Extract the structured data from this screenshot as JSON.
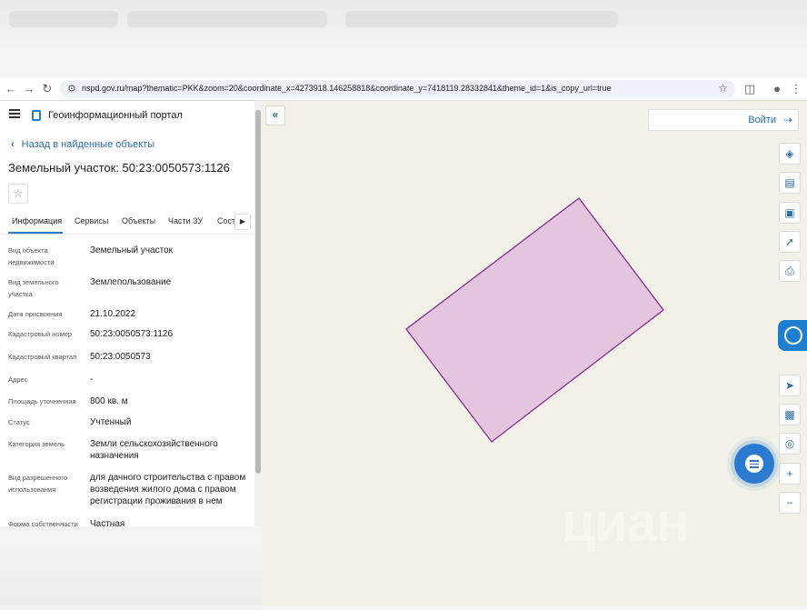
{
  "browser": {
    "url": "nspd.gov.ru/map?thematic=PKK&zoom=20&coordinate_x=4273918.146258818&coordinate_y=7418119.28332841&theme_id=1&is_copy_url=true"
  },
  "header": {
    "portal_title": "Геоинформационный портал",
    "login_label": "Войти"
  },
  "panel": {
    "back_label": "Назад в найденные объекты",
    "object_title": "Земельный участок: 50:23:0050573:1126",
    "tabs": [
      {
        "label": "Информация"
      },
      {
        "label": "Сервисы"
      },
      {
        "label": "Объекты"
      },
      {
        "label": "Части ЗУ"
      },
      {
        "label": "Соста"
      }
    ],
    "rows": [
      {
        "label": "Вид объекта недвижимости",
        "value": "Земельный участок"
      },
      {
        "label": "Вид земельного участка",
        "value": "Землепользование"
      },
      {
        "label": "Дата присвоения",
        "value": "21.10.2022"
      },
      {
        "label": "Кадастровый номер",
        "value": "50:23:0050573:1126"
      },
      {
        "label": "Кадастровый квартал",
        "value": "50:23:0050573"
      },
      {
        "label": "Адрес",
        "value": "-"
      },
      {
        "label": "Площадь уточненная",
        "value": "800 кв. м"
      },
      {
        "label": "Статус",
        "value": "Учтенный"
      },
      {
        "label": "Категория земель",
        "value": "Земли сельскохозяйственного назначения"
      },
      {
        "label": "Вид разрешенного использования",
        "value": "для дачного строительства с правом возведения жилого дома с правом регистрации проживания в нем"
      },
      {
        "label": "Форма собственности",
        "value": "Частная"
      }
    ]
  },
  "map": {
    "parcel_fill": "#e3c6de",
    "parcel_stroke": "#8a2a98",
    "tools": [
      "layers-icon",
      "ruler-icon",
      "select-area-icon",
      "share-icon",
      "print-icon",
      "locate-icon",
      "minimap-icon",
      "geolocation-icon",
      "zoom-in-icon",
      "zoom-out-icon"
    ]
  },
  "watermark": "циан",
  "colors": {
    "accent": "#2a7bc0"
  }
}
